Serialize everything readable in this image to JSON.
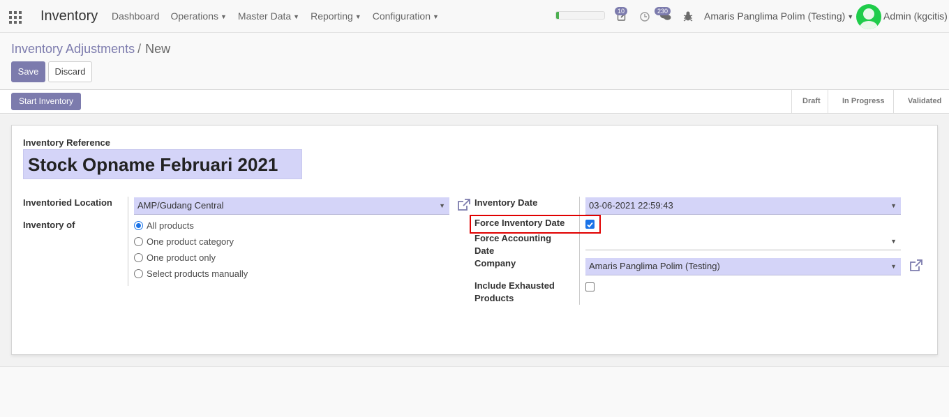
{
  "navbar": {
    "app_title": "Inventory",
    "menu": [
      {
        "label": "Dashboard",
        "has_caret": false
      },
      {
        "label": "Operations",
        "has_caret": true
      },
      {
        "label": "Master Data",
        "has_caret": true
      },
      {
        "label": "Reporting",
        "has_caret": true
      },
      {
        "label": "Configuration",
        "has_caret": true
      }
    ],
    "progress_fraction": 0.06,
    "activities_badge": "10",
    "messages_badge": "230",
    "company": "Amaris Panglima Polim (Testing)",
    "user": "Admin (kgcitis)"
  },
  "breadcrumb": {
    "parent": "Inventory Adjustments",
    "separator": "/",
    "current": "New"
  },
  "buttons": {
    "save": "Save",
    "discard": "Discard",
    "start_inventory": "Start Inventory"
  },
  "status_stages": [
    "Draft",
    "In Progress",
    "Validated"
  ],
  "form": {
    "reference_label": "Inventory Reference",
    "reference_value": "Stock Opname Februari 2021",
    "location_label": "Inventoried Location",
    "location_value": "AMP/Gudang Central",
    "inventory_of_label": "Inventory of",
    "inventory_of_options": [
      {
        "label": "All products",
        "checked": true
      },
      {
        "label": "One product category",
        "checked": false
      },
      {
        "label": "One product only",
        "checked": false
      },
      {
        "label": "Select products manually",
        "checked": false
      }
    ],
    "date_label": "Inventory Date",
    "date_value": "03-06-2021 22:59:43",
    "force_date_label": "Force Inventory Date",
    "force_date_checked": true,
    "force_accounting_label": "Force Accounting Date",
    "force_accounting_value": "",
    "company_label": "Company",
    "company_value": "Amaris Panglima Polim (Testing)",
    "exhausted_label": "Include Exhausted Products",
    "exhausted_checked": false
  },
  "colors": {
    "accent": "#7c7bad",
    "highlight": "#e00000",
    "required_field": "#d4d4f8"
  }
}
